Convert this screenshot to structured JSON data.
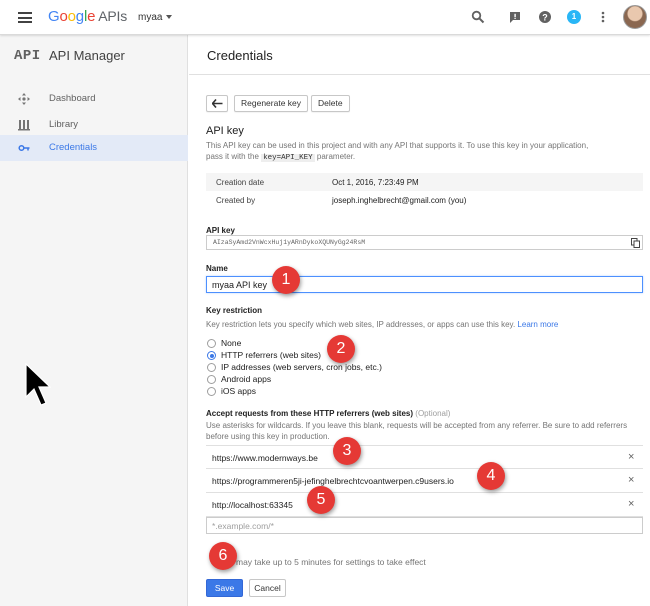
{
  "topbar": {
    "logo": {
      "letters": [
        "G",
        "o",
        "o",
        "g",
        "l",
        "e"
      ],
      "suffix": "APIs"
    },
    "project": "myaa",
    "icons": [
      "search-icon",
      "feedback-icon",
      "help-icon",
      "notifications-icon",
      "more-vert-icon"
    ],
    "notification_count": "1"
  },
  "sidebar": {
    "logo": "API",
    "title": "API Manager",
    "items": [
      {
        "label": "Dashboard",
        "icon": "dashboard-icon",
        "active": false
      },
      {
        "label": "Library",
        "icon": "library-icon",
        "active": false
      },
      {
        "label": "Credentials",
        "icon": "key-icon",
        "active": true
      }
    ]
  },
  "main": {
    "title": "Credentials",
    "toolbar": {
      "back_icon": "back-arrow-icon",
      "regenerate_label": "Regenerate key",
      "delete_label": "Delete"
    },
    "api_key_section": {
      "title": "API key",
      "desc_line1": "This API key can be used in this project and with any API that supports it. To use this key in your application,",
      "desc_line2_pre": "pass it with the",
      "desc_code": "key=API_KEY",
      "desc_line2_post": "parameter.",
      "info": [
        {
          "key": "Creation date",
          "value": "Oct 1, 2016, 7:23:49 PM"
        },
        {
          "key": "Created by",
          "value": "joseph.inghelbrecht@gmail.com (you)"
        }
      ],
      "api_key_label": "API key",
      "api_key_value": "AIzaSyAmd2VnWcxHuj1yARnDykoXQUNyGg24RsM"
    },
    "name_section": {
      "label": "Name",
      "value": "myaa API key"
    },
    "restriction": {
      "title": "Key restriction",
      "desc": "Key restriction lets you specify which web sites, IP addresses, or apps can use this key.",
      "learn_more": "Learn more",
      "options": [
        {
          "label": "None",
          "checked": false
        },
        {
          "label": "HTTP referrers (web sites)",
          "checked": true
        },
        {
          "label": "IP addresses (web servers, cron jobs, etc.)",
          "checked": false
        },
        {
          "label": "Android apps",
          "checked": false
        },
        {
          "label": "iOS apps",
          "checked": false
        }
      ]
    },
    "referrers": {
      "title": "Accept requests from these HTTP referrers (web sites)",
      "optional": "(Optional)",
      "desc_line1": "Use asterisks for wildcards. If you leave this blank, requests will be accepted from any referrer. Be sure to add referrers",
      "desc_line2": "before using this key in production.",
      "items": [
        "https://www.modernways.be",
        "https://programmeren5ji-jefinghelbrechtcvoantwerpen.c9users.io",
        "http://localhost:63345"
      ],
      "remove_icon": "×",
      "placeholder": "*.example.com/*"
    },
    "note": "may take up to 5 minutes for settings to take effect",
    "save_label": "Save",
    "cancel_label": "Cancel"
  },
  "callouts": [
    "1",
    "2",
    "3",
    "4",
    "5",
    "6"
  ]
}
